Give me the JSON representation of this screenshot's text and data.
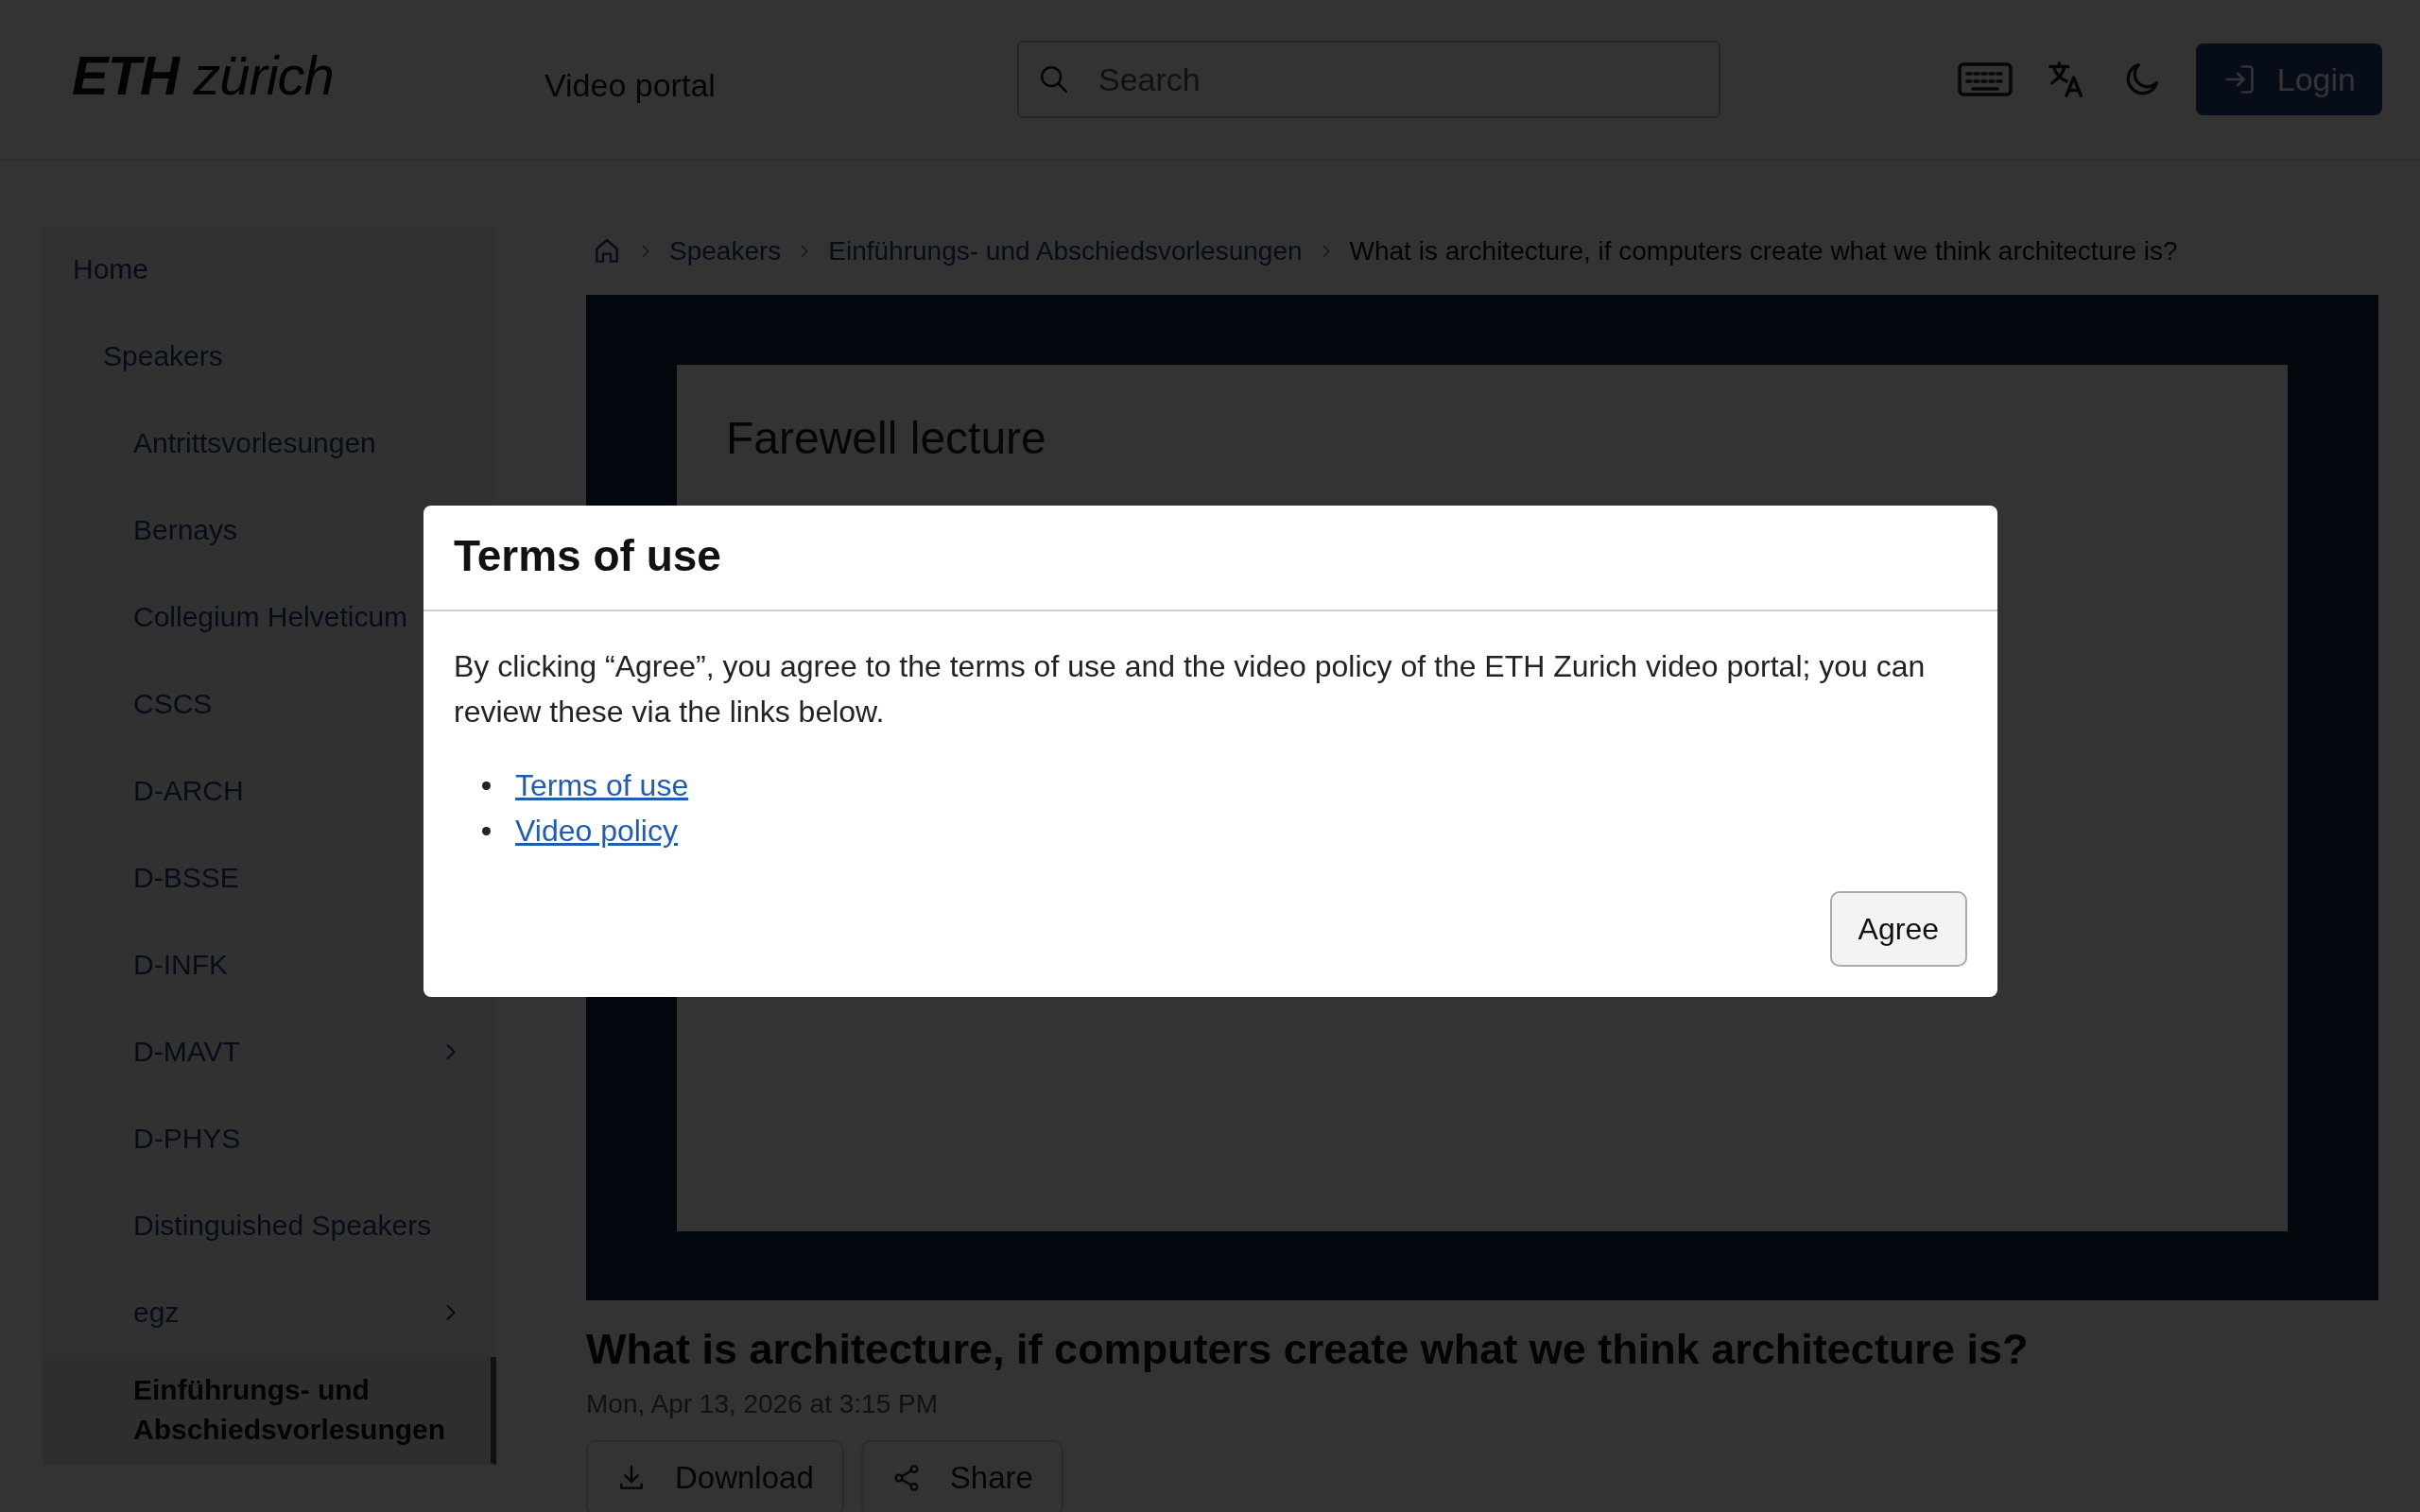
{
  "header": {
    "logo": "**ETH** *zürich*",
    "site_name": "Video portal",
    "search": {
      "placeholder": "Search"
    },
    "login_button": "Login"
  },
  "sidebar": {
    "items": [
      {
        "label": "Home",
        "selected": false,
        "expandable": false,
        "children": [
          {
            "label": "Speakers",
            "selected": false,
            "expandable": false,
            "children": [
              {
                "label": "Antrittsvorlesungen",
                "selected": false,
                "expandable": false
              },
              {
                "label": "Bernays",
                "selected": false
              },
              {
                "label": "Collegium Helveticum",
                "selected": false
              },
              {
                "label": "CSCS",
                "selected": false
              },
              {
                "label": "D-ARCH",
                "selected": false
              },
              {
                "label": "D-BSSE",
                "selected": false
              },
              {
                "label": "D-INFK",
                "selected": false
              },
              {
                "label": "D-MAVT",
                "selected": false,
                "expandable": true
              },
              {
                "label": "D-PHYS",
                "selected": false,
                "expandable": false
              },
              {
                "label": "Distinguished Speakers",
                "selected": false,
                "expandable": false
              },
              {
                "label": "egz",
                "selected": false,
                "expandable": true
              },
              {
                "label": "Einführungs- und Abschiedsvorlesungen",
                "selected": true,
                "expandable": false
              }
            ]
          }
        ]
      }
    ]
  },
  "breadcrumb": [
    {
      "label": "Speakers",
      "current": false
    },
    {
      "label": "Einführungs- und Abschiedsvorlesungen",
      "current": false
    },
    {
      "label": "What is architecture, if computers create what we think architecture is?",
      "current": true
    }
  ],
  "video": {
    "slide_title": "Farewell lecture"
  },
  "title": "What is architecture, if computers create what we think architecture is?",
  "date": "Mon, Apr 13, 2026 at 3:15 PM",
  "actions": [
    {
      "kind": "download",
      "label": "Download"
    },
    {
      "kind": "share",
      "label": "Share"
    }
  ],
  "modal": {
    "title": "Terms of use",
    "text": "By clicking “Agree”, you agree to the terms of use and the video policy of the ETH Zurich video portal; you can review these via the links below.",
    "links": [
      "Terms of use",
      "Video policy"
    ],
    "button": "Agree"
  }
}
